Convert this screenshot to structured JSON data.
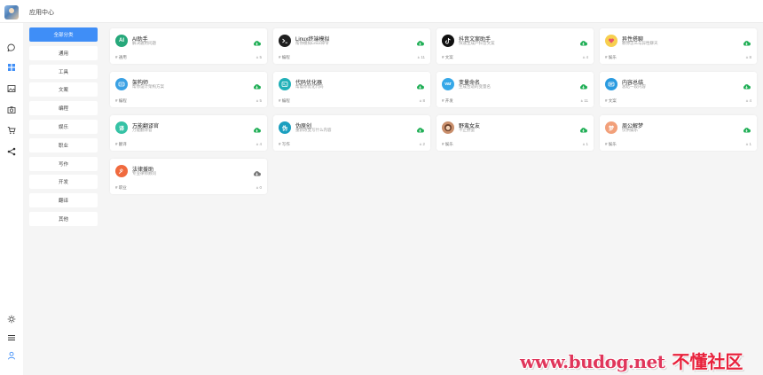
{
  "header": {
    "app_title": "应用中心"
  },
  "rail": {
    "top": [
      "chat-icon",
      "grid-icon",
      "image-icon",
      "camera-icon",
      "cart-icon",
      "share-icon"
    ],
    "bottom": [
      "theme-icon",
      "menu-icon",
      "user-icon"
    ]
  },
  "categories": [
    {
      "label": "全部分类",
      "active": true
    },
    {
      "label": "通用"
    },
    {
      "label": "工具"
    },
    {
      "label": "文案"
    },
    {
      "label": "编程"
    },
    {
      "label": "娱乐"
    },
    {
      "label": "职业"
    },
    {
      "label": "写作"
    },
    {
      "label": "开发"
    },
    {
      "label": "翻译"
    },
    {
      "label": "其他"
    }
  ],
  "apps": [
    {
      "title": "AI助手",
      "desc": "解决通用问题",
      "tag": "# 通用",
      "count": "± 5",
      "avatar": "AI",
      "color": "#26a87a",
      "icon": "ai-icon"
    },
    {
      "title": "Linux终端模拟",
      "desc": "帮你模拟Linux命令",
      "tag": "# 编程",
      "count": "± 11",
      "avatar": "",
      "color": "#1f1f1f",
      "icon": "terminal-icon"
    },
    {
      "title": "抖音文案助手",
      "desc": "快速生成产抖音文案",
      "tag": "# 文案",
      "count": "± 4",
      "avatar": "",
      "color": "#111111",
      "icon": "tiktok-icon"
    },
    {
      "title": "异性搭聊",
      "desc": "教你怎么与异性聊天",
      "tag": "# 娱乐",
      "count": "± 8",
      "avatar": "",
      "color": "#f7cf4f",
      "icon": "heart-icon"
    },
    {
      "title": "架构师",
      "desc": "帮你设计架构方案",
      "tag": "# 编程",
      "count": "± 5",
      "avatar": "",
      "color": "#3aa1e4",
      "icon": "architect-icon"
    },
    {
      "title": "代码优化器",
      "desc": "帮着你优化代码",
      "tag": "# 编程",
      "count": "± 8",
      "avatar": "",
      "color": "#21b0b8",
      "icon": "code-icon"
    },
    {
      "title": "变量命名",
      "desc": "生成合适的变量名",
      "tag": "# 开发",
      "count": "± 11",
      "avatar": "var",
      "color": "#36a8e8",
      "icon": "var-icon"
    },
    {
      "title": "内容总结",
      "desc": "总结一段内容",
      "tag": "# 文案",
      "count": "± 4",
      "avatar": "",
      "color": "#2a9be0",
      "icon": "summary-icon"
    },
    {
      "title": "万能翻译官",
      "desc": "万能翻译官",
      "tag": "# 翻译",
      "count": "± 4",
      "avatar": "译",
      "color": "#35c2a5",
      "icon": "translate-icon"
    },
    {
      "title": "伪原创",
      "desc": "重新改变写什么内容",
      "tag": "# 写作",
      "count": "± 2",
      "avatar": "伪",
      "color": "#1a9fbf",
      "icon": "rewrite-icon"
    },
    {
      "title": "野蛮女友",
      "desc": "不止野蛮",
      "tag": "# 娱乐",
      "count": "± 1",
      "avatar": "",
      "color": "#c98f6c",
      "icon": "girlfriend-avatar"
    },
    {
      "title": "周公解梦",
      "desc": "仅供娱乐",
      "tag": "# 娱乐",
      "count": "± 1",
      "avatar": "梦",
      "color": "#f2a07a",
      "icon": "dream-icon"
    },
    {
      "title": "法律援助",
      "desc": "专业律师顾问",
      "tag": "# 职业",
      "count": "± 0",
      "avatar": "",
      "color": "#f06a3e",
      "icon": "law-icon"
    }
  ],
  "colors": {
    "accent": "#3f8ef7",
    "download": "#1fae55",
    "download_muted": "#777777",
    "background": "#f5f5f5"
  },
  "watermark": {
    "url": "www.budog.net",
    "name": "不懂社区"
  }
}
